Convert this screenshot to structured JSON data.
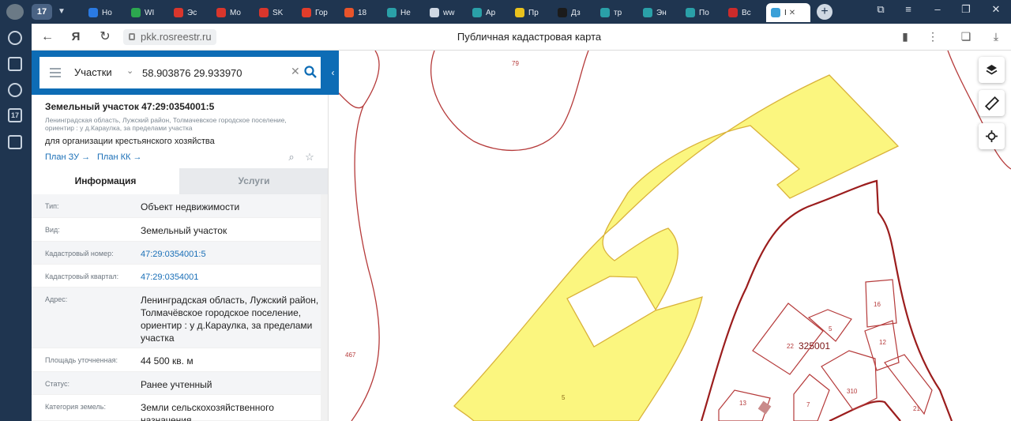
{
  "browser": {
    "tab_counter": "17",
    "tabs": [
      {
        "label": "Но",
        "color": "#2a7ae2"
      },
      {
        "label": "WI",
        "color": "#2ca84f"
      },
      {
        "label": "Эс",
        "color": "#d9362c"
      },
      {
        "label": "Mo",
        "color": "#d9362c"
      },
      {
        "label": "SK",
        "color": "#d9362c"
      },
      {
        "label": "Гор",
        "color": "#e23d2b"
      },
      {
        "label": "18",
        "color": "#e8542a"
      },
      {
        "label": "Не",
        "color": "#2aa0a8"
      },
      {
        "label": "ww",
        "color": "#cfd8e3"
      },
      {
        "label": "Ар",
        "color": "#2aa0a8"
      },
      {
        "label": "Пр",
        "color": "#e9c21d"
      },
      {
        "label": "Дз",
        "color": "#1b1b1b"
      },
      {
        "label": "тр",
        "color": "#2aa0a8"
      },
      {
        "label": "Эн",
        "color": "#2aa0a8"
      },
      {
        "label": "По",
        "color": "#2aa0a8"
      },
      {
        "label": "Вс",
        "color": "#cc2b2b"
      },
      {
        "label": "I",
        "color": "#3aa0d8"
      }
    ],
    "url": "pkk.rosreestr.ru",
    "page_title": "Публичная кадастровая карта"
  },
  "search": {
    "type_label": "Участки",
    "query": "58.903876 29.933970"
  },
  "object": {
    "title": "Земельный участок 47:29:0354001:5",
    "subtitle": "Ленинградская область, Лужский район, Толмачевское городское поселение, ориентир : у д.Караулка, за пределами участка",
    "use": "для организации крестьянского хозяйства",
    "plan_zu": "План ЗУ",
    "plan_kk": "План КК"
  },
  "panel_tabs": {
    "info": "Информация",
    "services": "Услуги"
  },
  "rows": [
    {
      "label": "Тип:",
      "value": "Объект недвижимости",
      "link": false
    },
    {
      "label": "Вид:",
      "value": "Земельный участок",
      "link": false
    },
    {
      "label": "Кадастровый номер:",
      "value": "47:29:0354001:5",
      "link": true
    },
    {
      "label": "Кадастровый квартал:",
      "value": "47:29:0354001",
      "link": true
    },
    {
      "label": "Адрес:",
      "value": "Ленинградская область, Лужский район, Толмачёвское городское поселение, ориентир : у д.Караулка, за пределами участка",
      "link": false
    },
    {
      "label": "Площадь уточненная:",
      "value": "44 500 кв. м",
      "link": false
    },
    {
      "label": "Статус:",
      "value": "Ранее учтенный",
      "link": false
    },
    {
      "label": "Категория земель:",
      "value": "Земли сельскохозяйственного назначения",
      "link": false
    }
  ],
  "map_labels": {
    "l79": "79",
    "l467": "467",
    "l5": "5",
    "l16": "16",
    "l5b": "5",
    "l12": "12",
    "l22": "22",
    "quarter": "325001",
    "l310": "310",
    "l13": "13",
    "l7": "7",
    "l21": "21"
  },
  "colors": {
    "parcel_fill": "#fbf67f",
    "parcel_stroke": "#d9b23a",
    "boundary": "#b53a3a",
    "quarter_boundary": "#9b1d1d",
    "accent": "#0d6cb5"
  }
}
